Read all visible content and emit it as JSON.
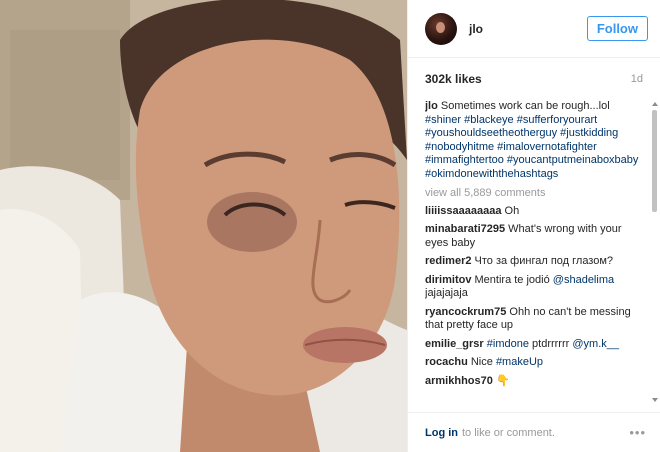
{
  "post": {
    "username": "jlo",
    "follow_label": "Follow",
    "likes": "302k likes",
    "age": "1d",
    "caption": {
      "user": "jlo",
      "text": "Sometimes work can be rough...lol",
      "tags": "#shiner #blackeye #sufferforyourart #youshouldseetheotherguy #justkidding #nobodyhitme #imalovernotafighter #immafightertoo #youcantputmeinaboxbaby #okimdonewiththehashtags"
    },
    "view_all": "view all 5,889 comments",
    "comments": [
      {
        "user": "liiiissaaaaaaaa",
        "text": "Oh"
      },
      {
        "user": "minabarati7295",
        "text": "What's wrong with your eyes baby"
      },
      {
        "user": "redimer2",
        "text": "Что за фингал под глазом?"
      },
      {
        "user": "dirimitov",
        "text": "Mentira te jodió",
        "mention": "@shadelima",
        "after": "jajajajaja"
      },
      {
        "user": "ryancockrum75",
        "text": "Ohh no can't be messing that pretty face up"
      },
      {
        "user": "emilie_grsr",
        "tag": "#imdone",
        "text": "ptdrrrrrr",
        "mention": "@ym.k__"
      },
      {
        "user": "rocachu",
        "text": "Nice",
        "tag": "#makeUp"
      },
      {
        "user": "armikhhos70",
        "text": "👇"
      }
    ],
    "footer": {
      "login": "Log in",
      "text": "to like or comment.",
      "more": "•••"
    }
  },
  "icons": {
    "more": "more-options-icon",
    "scroll_up": "scroll-up-arrow-icon",
    "scroll_down": "scroll-down-arrow-icon"
  }
}
